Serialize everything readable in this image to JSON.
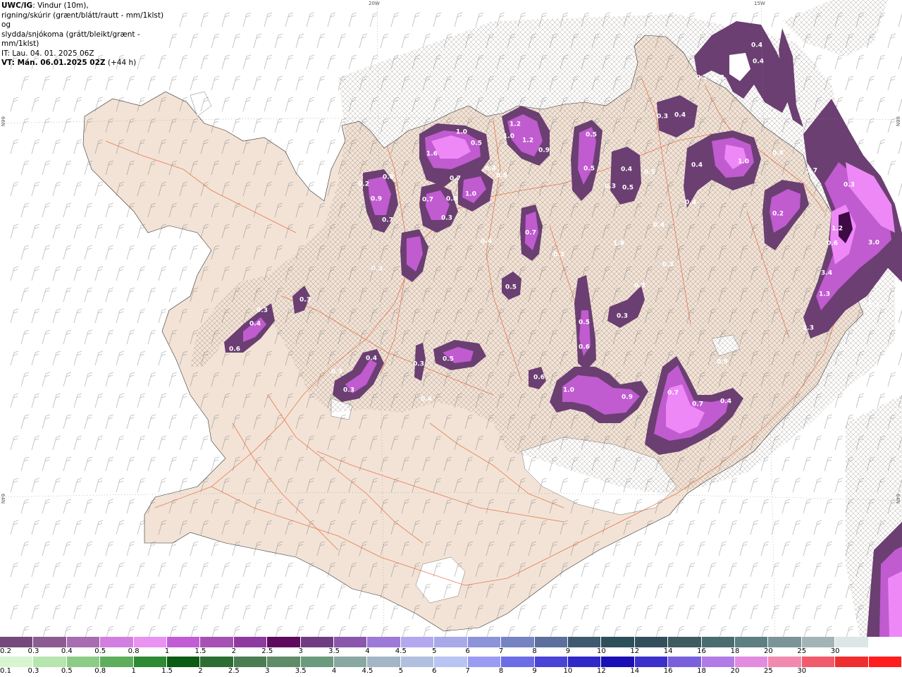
{
  "title": {
    "line1_bold": "UWC/IG",
    "line1_rest": ": Vindur (10m),",
    "line2": "rigning/skúrir (grænt/blátt/rautt - mm/1klst) og",
    "line3": "slydda/snjókoma (grátt/bleikt/grænt - mm/1klst)",
    "line4": "IT: Lau. 04. 01. 2025 06Z",
    "line5_bold": "VT: Mán. 06.01.2025 02Z",
    "line5_rest": " (+44 h)"
  },
  "coords": {
    "top_20w": "20W",
    "top_15w": "15W",
    "left_66n": "66N",
    "right_66n": "66N",
    "left_64n": "64N",
    "right_64n": "64N"
  },
  "colors": {
    "land": "#f2e3d6",
    "sea": "#ffffff",
    "roads": "#e8663a",
    "snow_light": "#6a3f73",
    "snow_mid": "#c05bd0",
    "snow_high": "#ee88f7",
    "snow_peak": "#3d0a45"
  },
  "snow_scale": {
    "labels": [
      "0.2",
      "0.3",
      "0.4",
      "0.5",
      "0.8",
      "1",
      "1.5",
      "2",
      "2.5",
      "3",
      "3.5",
      "4",
      "4.5",
      "5",
      "6",
      "7",
      "8",
      "9",
      "10",
      "12",
      "14",
      "16",
      "18",
      "20",
      "25",
      "30"
    ],
    "colors": [
      "#744a7a",
      "#8c5b92",
      "#a86cb0",
      "#d27ee0",
      "#e892f2",
      "#c25cd6",
      "#a650b5",
      "#8e3aa0",
      "#5e0a5e",
      "#6f3c82",
      "#8a57ad",
      "#9e7ad8",
      "#b3a8ef",
      "#a7a9e8",
      "#8c93d9",
      "#7683c2",
      "#5c6f9d",
      "#3f5a6e",
      "#2d4f5a",
      "#344f5c",
      "#3e5b60",
      "#4a6c70",
      "#5e7f81",
      "#7b9497",
      "#a2b4b6",
      "#dde6e7",
      "#ffffff"
    ]
  },
  "rain_scale": {
    "labels": [
      "0.1",
      "0.3",
      "0.5",
      "0.8",
      "1",
      "1.5",
      "2",
      "2.5",
      "3",
      "3.5",
      "4",
      "4.5",
      "5",
      "6",
      "7",
      "8",
      "9",
      "10",
      "12",
      "14",
      "16",
      "18",
      "20",
      "25",
      "30"
    ],
    "colors": [
      "#d8f5d2",
      "#b6e5ad",
      "#8ccc86",
      "#5fae5d",
      "#2f8a34",
      "#0b5b12",
      "#2d6d34",
      "#4a7d52",
      "#5f8b69",
      "#6c9a7c",
      "#8aa8a2",
      "#a3b6c7",
      "#b0c0de",
      "#b8c4f2",
      "#9a9cf3",
      "#6c6ce6",
      "#4a43d6",
      "#3129c6",
      "#1a0fb2",
      "#3b30c9",
      "#7a60dc",
      "#b07be6",
      "#e38bde",
      "#f28ab0",
      "#f05a6a",
      "#ef2f2f",
      "#ff1d1d"
    ]
  },
  "precip_labels": [
    "1.0",
    "0.5",
    "1.6",
    "0.7",
    "0.4",
    "0.5",
    "0.8",
    "0.2",
    "0.9",
    "0.7",
    "0.7",
    "0.8",
    "0.3",
    "1.0",
    "1.2",
    "1.2",
    "1.0",
    "0.9",
    "0.5",
    "0.4",
    "0.5",
    "0.3",
    "0.5",
    "0.5",
    "0.4",
    "0.4",
    "0.3",
    "0.4",
    "1.0",
    "0.2",
    "0.3",
    "0.4",
    "0.4",
    "0.4",
    "0.2",
    "1.7",
    "0.3",
    "1.2",
    "0.6",
    "3.0",
    "3.4",
    "1.3",
    "2.3",
    "1.1",
    "0.7",
    "0.3",
    "1.8",
    "0.3",
    "0.3",
    "0.4",
    "0.3",
    "0.5",
    "0.6",
    "0.6",
    "0.5",
    "0.4",
    "0.3",
    "0.4",
    "0.3",
    "0.6",
    "0.4",
    "0.3",
    "0.5",
    "0.3",
    "0.4",
    "1.0",
    "0.9",
    "0.7",
    "0.7",
    "0.4",
    "0.3",
    "0.5",
    "0.3"
  ]
}
